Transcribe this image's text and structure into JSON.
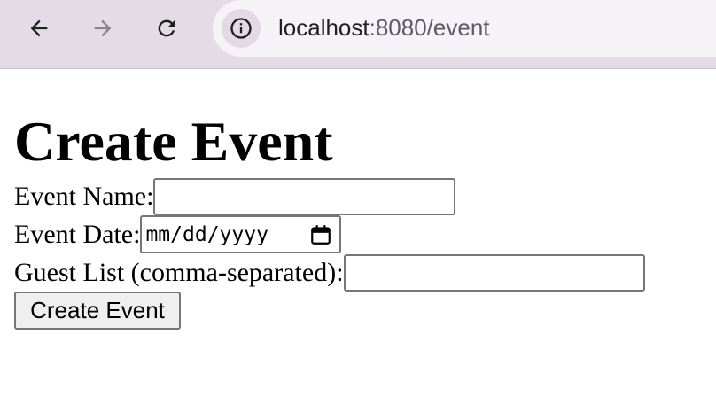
{
  "browser": {
    "url_host": "localhost",
    "url_rest": ":8080/event"
  },
  "page": {
    "title": "Create Event",
    "form": {
      "event_name_label": "Event Name:",
      "event_name_value": "",
      "event_date_label": "Event Date:",
      "event_date_placeholder": "mm/dd/yyyy",
      "guest_list_label": "Guest List (comma-separated):",
      "guest_list_value": "",
      "submit_label": "Create Event"
    }
  }
}
